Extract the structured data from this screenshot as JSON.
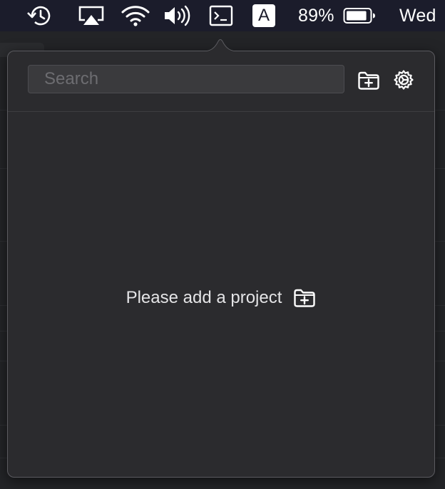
{
  "menubar": {
    "icons": [
      "time-machine-icon",
      "airplay-icon",
      "wifi-icon",
      "volume-icon",
      "terminal-icon"
    ],
    "input_source_label": "A",
    "battery_percent_text": "89%",
    "battery_level": 0.89,
    "clock_text": "Wed"
  },
  "popover": {
    "search": {
      "placeholder": "Search",
      "value": ""
    },
    "toolbar_icons": [
      "add-folder-icon",
      "gear-icon"
    ],
    "empty_state": {
      "message": "Please add a project",
      "icon": "add-folder-icon"
    }
  },
  "colors": {
    "menubar_bg": "#1b1c2b",
    "popover_bg": "#2b2b2e",
    "popover_border": "#5b5b60",
    "search_bg": "#3a3a3d",
    "text_primary": "#e4e4e6",
    "placeholder": "#6d6d71"
  }
}
